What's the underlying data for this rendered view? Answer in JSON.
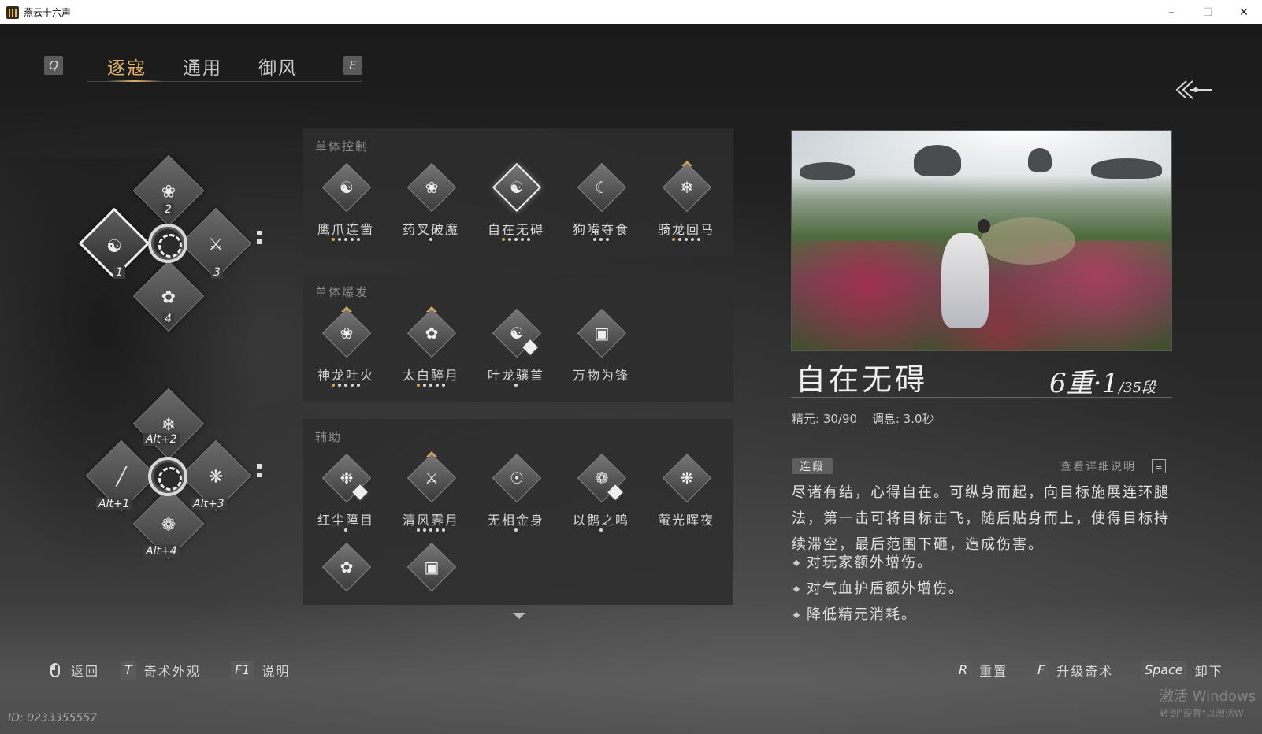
{
  "window": {
    "title": "燕云十六声"
  },
  "tabs": {
    "prev_key": "Q",
    "next_key": "E",
    "items": [
      {
        "label": "逐寇",
        "active": true
      },
      {
        "label": "通用",
        "active": false
      },
      {
        "label": "御风",
        "active": false
      }
    ]
  },
  "wheel_primary": {
    "slot_keys": [
      "1",
      "2",
      "3",
      "4"
    ],
    "icons": [
      "martial-pose-icon",
      "flame-claw-icon",
      "crossed-blades-icon",
      "dragon-kick-icon"
    ]
  },
  "wheel_alt": {
    "slot_keys": [
      "Alt+1",
      "Alt+2",
      "Alt+3",
      "Alt+4"
    ],
    "icons": [
      "slash-icon",
      "wing-blade-icon",
      "bell-sweep-icon",
      "whirlwind-icon"
    ]
  },
  "panels": [
    {
      "title": "单体控制",
      "skills": [
        {
          "name": "鹰爪连凿",
          "icon": "eagle-claw-icon",
          "dots": 5,
          "gold_dots": 1
        },
        {
          "name": "药叉破魔",
          "icon": "yaksha-icon",
          "dots": 1,
          "gold_dots": 0
        },
        {
          "name": "自在无碍",
          "icon": "free-flow-icon",
          "dots": 5,
          "gold_dots": 1,
          "selected": true
        },
        {
          "name": "狗嘴夺食",
          "icon": "snatch-icon",
          "dots": 3,
          "gold_dots": 0
        },
        {
          "name": "骑龙回马",
          "icon": "dragon-ride-icon",
          "dots": 5,
          "gold_dots": 1,
          "crown": true
        }
      ]
    },
    {
      "title": "单体爆发",
      "skills": [
        {
          "name": "神龙吐火",
          "icon": "dragon-fire-icon",
          "dots": 5,
          "gold_dots": 1,
          "crown": true
        },
        {
          "name": "太白醉月",
          "icon": "drunk-moon-icon",
          "dots": 5,
          "gold_dots": 1,
          "crown": true
        },
        {
          "name": "叶龙骧首",
          "icon": "leaf-dragon-icon",
          "dots": 1,
          "gold_dots": 0,
          "badge": true
        },
        {
          "name": "万物为锋",
          "icon": "chest-icon",
          "dots": 0,
          "gold_dots": 0
        }
      ]
    },
    {
      "title": "辅助",
      "skills": [
        {
          "name": "红尘障目",
          "icon": "dust-veil-icon",
          "dots": 1,
          "gold_dots": 0,
          "badge": true
        },
        {
          "name": "清风霁月",
          "icon": "breeze-moon-icon",
          "dots": 5,
          "gold_dots": 0,
          "crown": true
        },
        {
          "name": "无相金身",
          "icon": "golden-body-icon",
          "dots": 1,
          "gold_dots": 0
        },
        {
          "name": "以鹅之鸣",
          "icon": "goose-cry-icon",
          "dots": 1,
          "gold_dots": 0,
          "badge": true
        },
        {
          "name": "萤光晖夜",
          "icon": "firefly-icon",
          "dots": 0,
          "gold_dots": 0
        },
        {
          "name": "",
          "icon": "figure-icon",
          "dots": 0,
          "gold_dots": 0
        },
        {
          "name": "",
          "icon": "chest-icon",
          "dots": 0,
          "gold_dots": 0
        }
      ]
    }
  ],
  "detail": {
    "name": "自在无碍",
    "level_main": "6重·1",
    "level_sub": "/35段",
    "stat_jingyuan": "精元: 30/90",
    "stat_tiaoxi": "调息: 3.0秒",
    "tag": "连段",
    "view_more": "查看详细说明",
    "description": "尽诸有结，心得自在。可纵身而起，向目标施展连环腿法，第一击可将目标击飞，随后贴身而上，使得目标持续滞空，最后范围下砸，造成伤害。",
    "bullets": [
      "对玩家额外增伤。",
      "对气血护盾额外增伤。",
      "降低精元消耗。"
    ]
  },
  "bottom": {
    "back_label": "返回",
    "appearance_key": "T",
    "appearance_label": "奇术外观",
    "help_key": "F1",
    "help_label": "说明",
    "reset_key": "R",
    "reset_label": "重置",
    "upgrade_key": "F",
    "upgrade_label": "升级奇术",
    "unequip_key": "Space",
    "unequip_label": "卸下",
    "player_id": "ID: 0233355557",
    "watermark_line1": "激活 Windows",
    "watermark_line2": "转到\"设置\"以激活W"
  }
}
